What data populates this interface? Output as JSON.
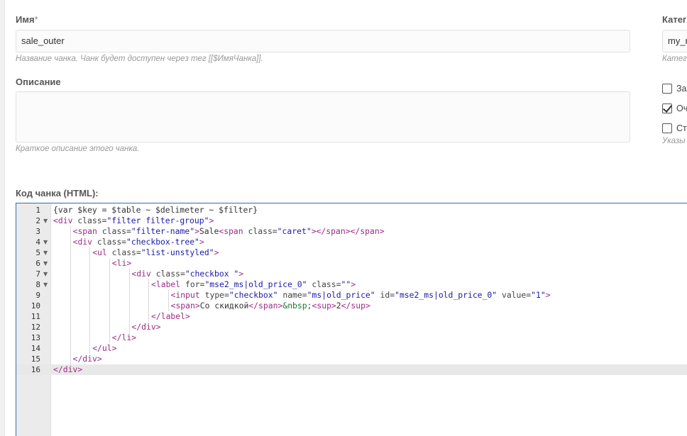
{
  "form": {
    "name_label": "Имя",
    "name_required": "*",
    "name_value": "sale_outer",
    "name_hint": "Название чанка. Чанк будет доступен через тег [[$ИмяЧанка]].",
    "description_label": "Описание",
    "description_value": "",
    "description_hint": "Краткое описание этого чанка.",
    "code_label": "Код чанка (HTML):"
  },
  "side": {
    "category_label": "Катег",
    "category_value": "my_r",
    "category_hint": "Катег",
    "checkboxes": [
      {
        "label": "За",
        "checked": false
      },
      {
        "label": "Оч",
        "checked": true
      },
      {
        "label": "Ст",
        "checked": false
      }
    ],
    "checkbox_hint": "Указы"
  },
  "editor": {
    "active_line": 16,
    "lines": [
      {
        "n": "1",
        "fold": "",
        "indent": 0,
        "html": "{var $key = $table ~ $delimeter ~ $filter}"
      },
      {
        "n": "2",
        "fold": "▼",
        "indent": 0,
        "html": "<span class='tag'>&lt;div</span> <span class='attr'>class=</span><span class='str'>\"filter filter-group\"</span><span class='tag'>&gt;</span>"
      },
      {
        "n": "3",
        "fold": "",
        "indent": 1,
        "html": "<span class='tag'>&lt;span</span> <span class='attr'>class=</span><span class='str'>\"filter-name\"</span><span class='tag'>&gt;</span>Sale<span class='tag'>&lt;span</span> <span class='attr'>class=</span><span class='str'>\"caret\"</span><span class='tag'>&gt;&lt;/span&gt;&lt;/span&gt;</span>"
      },
      {
        "n": "4",
        "fold": "▼",
        "indent": 1,
        "html": "<span class='tag'>&lt;div</span> <span class='attr'>class=</span><span class='str'>\"checkbox-tree\"</span><span class='tag'>&gt;</span>"
      },
      {
        "n": "5",
        "fold": "▼",
        "indent": 2,
        "html": "<span class='tag'>&lt;ul</span> <span class='attr'>class=</span><span class='str'>\"list-unstyled\"</span><span class='tag'>&gt;</span>"
      },
      {
        "n": "6",
        "fold": "▼",
        "indent": 3,
        "html": "<span class='tag'>&lt;li&gt;</span>"
      },
      {
        "n": "7",
        "fold": "▼",
        "indent": 4,
        "html": "<span class='tag'>&lt;div</span> <span class='attr'>class=</span><span class='str'>\"checkbox \"</span><span class='tag'>&gt;</span>"
      },
      {
        "n": "8",
        "fold": "▼",
        "indent": 5,
        "html": "<span class='tag'>&lt;label</span> <span class='attr'>for=</span><span class='str'>\"mse2_ms|old_price_0\"</span> <span class='attr'>class=</span><span class='str'>\"\"</span><span class='tag'>&gt;</span>"
      },
      {
        "n": "9",
        "fold": "",
        "indent": 6,
        "html": "<span class='tag'>&lt;input</span> <span class='attr'>type=</span><span class='str'>\"checkbox\"</span> <span class='attr'>name=</span><span class='str'>\"ms|old_price\"</span> <span class='attr'>id=</span><span class='str'>\"mse2_ms|old_price_0\"</span> <span class='attr'>value=</span><span class='str'>\"1\"</span><span class='tag'>&gt;</span>"
      },
      {
        "n": "10",
        "fold": "",
        "indent": 6,
        "html": "<span class='tag'>&lt;span&gt;</span>Со скидкой<span class='tag'>&lt;/span&gt;</span><span class='ent'>&amp;nbsp;</span><span class='tag'>&lt;sup&gt;</span>2<span class='tag'>&lt;/sup&gt;</span>"
      },
      {
        "n": "11",
        "fold": "",
        "indent": 5,
        "html": "<span class='tag'>&lt;/label&gt;</span>"
      },
      {
        "n": "12",
        "fold": "",
        "indent": 4,
        "html": "<span class='tag'>&lt;/div&gt;</span>"
      },
      {
        "n": "13",
        "fold": "",
        "indent": 3,
        "html": "<span class='tag'>&lt;/li&gt;</span>"
      },
      {
        "n": "14",
        "fold": "",
        "indent": 2,
        "html": "<span class='tag'>&lt;/ul&gt;</span>"
      },
      {
        "n": "15",
        "fold": "",
        "indent": 1,
        "html": "<span class='tag'>&lt;/div&gt;</span>"
      },
      {
        "n": "16",
        "fold": "",
        "indent": 0,
        "html": "<span class='tag'>&lt;/div&gt;</span>"
      }
    ]
  }
}
